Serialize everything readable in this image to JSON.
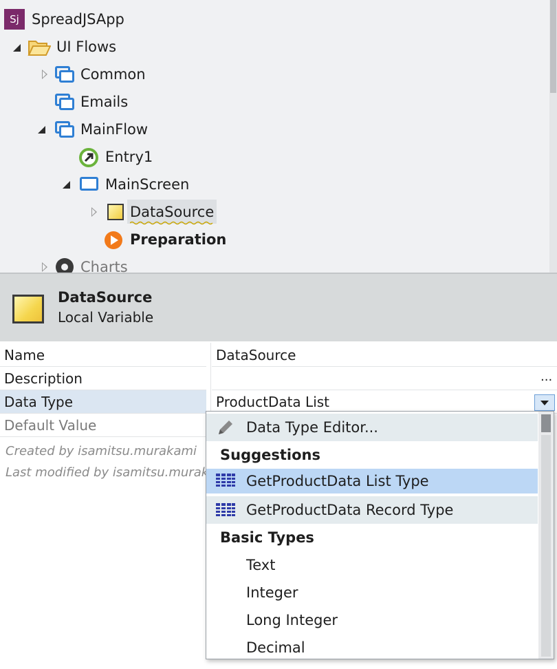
{
  "tree": {
    "app": {
      "badge": "Sj",
      "label": "SpreadJSApp"
    },
    "items": [
      {
        "label": "UI Flows"
      },
      {
        "label": "Common"
      },
      {
        "label": "Emails"
      },
      {
        "label": "MainFlow"
      },
      {
        "label": "Entry1"
      },
      {
        "label": "MainScreen"
      },
      {
        "label": "DataSource"
      },
      {
        "label": "Preparation"
      },
      {
        "label": "Charts"
      }
    ]
  },
  "header": {
    "title": "DataSource",
    "subtitle": "Local Variable"
  },
  "properties": {
    "name": {
      "key": "Name",
      "value": "DataSource"
    },
    "description": {
      "key": "Description",
      "value": "",
      "ellipsis": "..."
    },
    "data_type": {
      "key": "Data Type",
      "value": "ProductData List"
    },
    "default_value": {
      "key": "Default Value",
      "value": ""
    },
    "created": "Created by isamitsu.murakami",
    "modified": "Last modified by isamitsu.murakami"
  },
  "dropdown": {
    "editor": "Data Type Editor...",
    "suggestions_header": "Suggestions",
    "suggestions": [
      "GetProductData List Type",
      "GetProductData Record Type"
    ],
    "basic_header": "Basic Types",
    "basic": [
      "Text",
      "Integer",
      "Long Integer",
      "Decimal"
    ]
  },
  "colors": {
    "accent": "#2f7fd4",
    "selected": "#bcd7f5",
    "hover": "#e4ebee"
  }
}
